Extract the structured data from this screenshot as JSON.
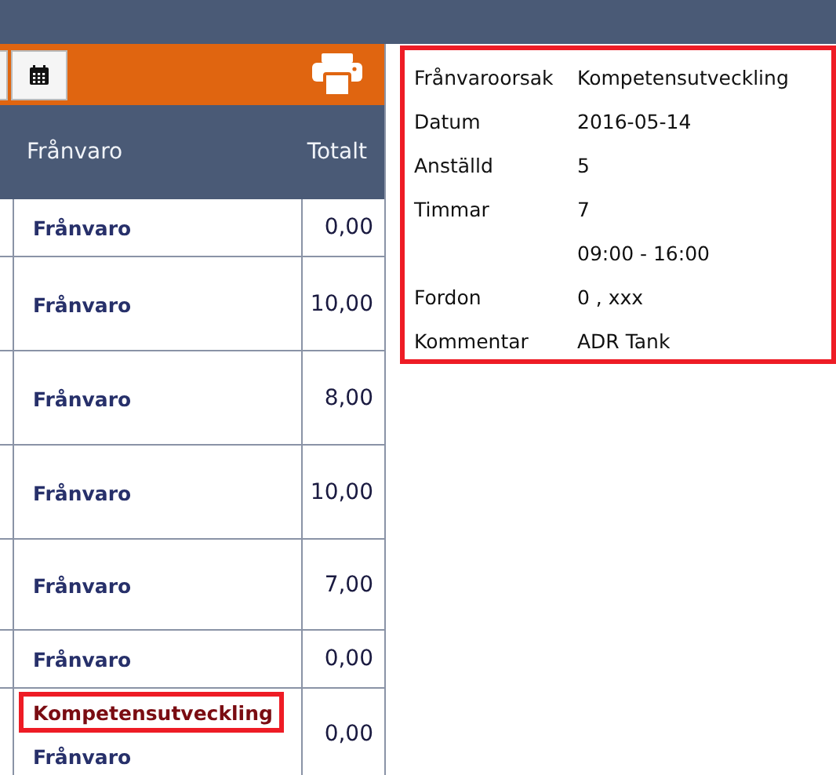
{
  "table": {
    "columns": [
      "Frånvaro",
      "Totalt"
    ],
    "rows": [
      {
        "entries": [
          {
            "text": "Frånvaro",
            "kind": "absence",
            "highlighted": false
          }
        ],
        "total": "0,00"
      },
      {
        "entries": [
          {
            "text": "Frånvaro",
            "kind": "absence",
            "highlighted": false
          }
        ],
        "total": "10,00"
      },
      {
        "entries": [
          {
            "text": "Frånvaro",
            "kind": "absence",
            "highlighted": false
          }
        ],
        "total": "8,00"
      },
      {
        "entries": [
          {
            "text": "Frånvaro",
            "kind": "absence",
            "highlighted": false
          }
        ],
        "total": "10,00"
      },
      {
        "entries": [
          {
            "text": "Frånvaro",
            "kind": "absence",
            "highlighted": false
          }
        ],
        "total": "7,00"
      },
      {
        "entries": [
          {
            "text": "Frånvaro",
            "kind": "absence",
            "highlighted": false
          }
        ],
        "total": "0,00"
      },
      {
        "entries": [
          {
            "text": "Kompetensutveckling",
            "kind": "cause",
            "highlighted": true
          },
          {
            "text": "Frånvaro",
            "kind": "absence",
            "highlighted": false
          }
        ],
        "total": "0,00"
      }
    ]
  },
  "details": {
    "highlighted": true,
    "rows": [
      {
        "label": "Frånvaroorsak",
        "value": "Kompetensutveckling"
      },
      {
        "label": "Datum",
        "value": "2016-05-14"
      },
      {
        "label": "Anställd",
        "value": "5"
      },
      {
        "label": "Timmar",
        "value": "7"
      },
      {
        "label": "",
        "value": "09:00 - 16:00"
      },
      {
        "label": "Fordon",
        "value": "0 , xxx"
      },
      {
        "label": "Kommentar",
        "value": "ADR Tank"
      }
    ]
  }
}
